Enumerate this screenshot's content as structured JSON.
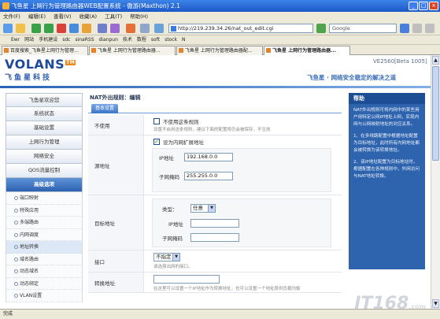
{
  "window": {
    "title": "飞鱼星 上网行为管理路由器WEB配置系统 - 傲游(Maxthon) 2.1"
  },
  "menu": [
    "文件(F)",
    "编辑(E)",
    "查看(V)",
    "收藏(A)",
    "工具(T)",
    "帮助(H)"
  ],
  "address": {
    "url": "http://219.239.34.26/nat_out_edit.cgi"
  },
  "search": {
    "placeholder": "Google"
  },
  "favorites": [
    "Ewr",
    "网站",
    "手机建设",
    "sdc",
    "sinaRSS",
    "dianpun",
    "技术",
    "数程",
    "soft",
    "stock",
    "N"
  ],
  "tabs": [
    "百度搜索_飞鱼星上网行为管理...",
    "飞鱼星 上网行为管理路由器...",
    "飞鱼星 上网行为管理路由器配...",
    "飞鱼星 上网行为管理路由器..."
  ],
  "header": {
    "logo": "VOLANS",
    "tm": "TM",
    "company": "飞鱼星科技",
    "version": "VE2560[Beta 1005]",
    "slogan": "飞鱼星 · 网络安全稳定的解决之道"
  },
  "sidebar": {
    "items": [
      "飞鱼星欢迎您",
      "系统状态",
      "基础设置",
      "上网行为管理",
      "网络安全",
      "QOS流量控制",
      "高级选项"
    ],
    "subitems": [
      "端口映射",
      "特殊应用",
      "多端路由",
      "内网调度",
      "地址转换",
      "域名路由",
      "动态域名",
      "动态绑定",
      "VLAN设置"
    ]
  },
  "page": {
    "title": "NAT外出规则：编辑",
    "tab": "基本设置",
    "disable": {
      "label": "不使用",
      "check_text": "不使用这条规则",
      "hint": "设置不启用这条规则，建议下面的配置将仍会被保存，不生效"
    },
    "src": {
      "label": "源地址",
      "check_text": "设为内网扩展地址",
      "ip_label": "IP地址",
      "ip": "192.168.0.0",
      "mask_label": "子网掩码",
      "mask": "255.255.0.0"
    },
    "dst": {
      "label": "目标地址",
      "type_label": "类型：",
      "type": "任意",
      "ip_label": "IP地址",
      "mask_label": "子网掩码"
    },
    "iface": {
      "label": "接口",
      "value": "不指定",
      "hint": "请选择出网的接口。"
    },
    "conv": {
      "label": "转换地址",
      "hint": "在这里可以设置一个IP地址作为转换地址，也可以设置一个地址段供负载均衡"
    }
  },
  "help": {
    "title": "帮助",
    "paras": [
      "NAT外出规则可将内网中的某些用户用特定公网IP地址上网，实现内网与公网映射地址的对应关系。",
      "1、在多线路配置中根据地址配置为目标地址，此时所有内网地址都会被转换为该转换地址。",
      "2、该IP地址配置为目标地址时，根据配置在各种规则中，外网访问与NAT地址转换。"
    ]
  },
  "status": {
    "text": "完成"
  },
  "watermark": "IT168",
  "watermark_sub": ".com"
}
